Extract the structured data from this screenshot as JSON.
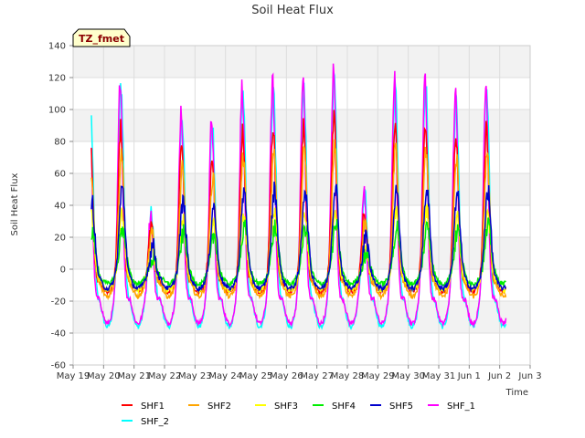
{
  "chart_data": {
    "type": "line",
    "title": "Soil Heat Flux",
    "xlabel": "Time",
    "ylabel": "Soil Heat Flux",
    "site_label": "TZ_fmet",
    "ylim": [
      -60,
      140
    ],
    "yticks": [
      -60,
      -40,
      -20,
      0,
      20,
      40,
      60,
      80,
      100,
      120,
      140
    ],
    "xlim": [
      0,
      15
    ],
    "xticks": [
      0,
      1,
      2,
      3,
      4,
      5,
      6,
      7,
      8,
      9,
      10,
      11,
      12,
      13,
      14,
      15
    ],
    "xtick_labels": [
      "May 19",
      "May 20",
      "May 21",
      "May 22",
      "May 23",
      "May 24",
      "May 25",
      "May 26",
      "May 27",
      "May 28",
      "May 29",
      "May 30",
      "May 31",
      "Jun 1",
      "Jun 2",
      "Jun 3"
    ],
    "x_data_start": 0.6,
    "x_data_end": 14.2,
    "samples_per_day": 48,
    "grid": true,
    "legend_position": "bottom",
    "daily_peaks_shf1_like": [
      105,
      120,
      35,
      100,
      95,
      115,
      118,
      120,
      125,
      48,
      120,
      122,
      110,
      118
    ],
    "series": [
      {
        "name": "SHF1",
        "color": "#ff0000",
        "peak_scale": 0.75,
        "min": -14,
        "peak_hour": 13.5,
        "width": 2.8,
        "lag": 0.0
      },
      {
        "name": "SHF2",
        "color": "#ffa500",
        "peak_scale": 0.62,
        "min": -17,
        "peak_hour": 13.8,
        "width": 3.0,
        "lag": 0.2
      },
      {
        "name": "SHF3",
        "color": "#ffff00",
        "peak_scale": 0.3,
        "min": -13,
        "peak_hour": 14.0,
        "width": 3.2,
        "lag": 0.3
      },
      {
        "name": "SHF4",
        "color": "#00ee00",
        "peak_scale": 0.22,
        "min": -9,
        "peak_hour": 14.5,
        "width": 3.6,
        "lag": 0.5
      },
      {
        "name": "SHF5",
        "color": "#0000cc",
        "peak_scale": 0.42,
        "min": -12,
        "peak_hour": 14.2,
        "width": 3.3,
        "lag": 0.4
      },
      {
        "name": "SHF_1",
        "color": "#ff00ff",
        "peak_scale": 1.0,
        "min": -34,
        "peak_hour": 13.2,
        "width": 2.6,
        "lag": -0.1
      },
      {
        "name": "SHF_2",
        "color": "#00ffff",
        "peak_scale": 0.96,
        "min": -36,
        "peak_hour": 13.6,
        "width": 3.0,
        "lag": 0.1
      }
    ]
  }
}
